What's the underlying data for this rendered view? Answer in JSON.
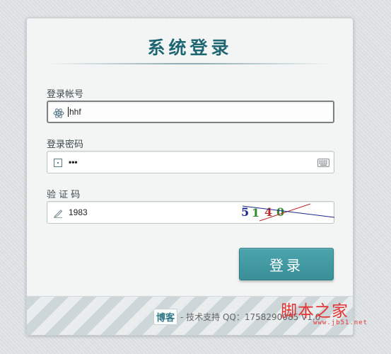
{
  "title": "系统登录",
  "account": {
    "label": "登录帐号",
    "value": "hhf"
  },
  "password": {
    "label": "登录密码",
    "value": "•••"
  },
  "captcha": {
    "label": "验 证 码",
    "value": "1983",
    "image_chars": [
      "5",
      "1",
      "4",
      "0"
    ]
  },
  "login_button": "登录",
  "footer": {
    "blog": "博客",
    "support": "- 技术支持 QQ：1758290085 V1.0"
  },
  "watermark": {
    "brand": "脚本之家",
    "url": "www.jb51.net"
  },
  "colors": {
    "accent": "#3a9aa3",
    "title": "#1f6673",
    "watermark": "#e43333"
  }
}
